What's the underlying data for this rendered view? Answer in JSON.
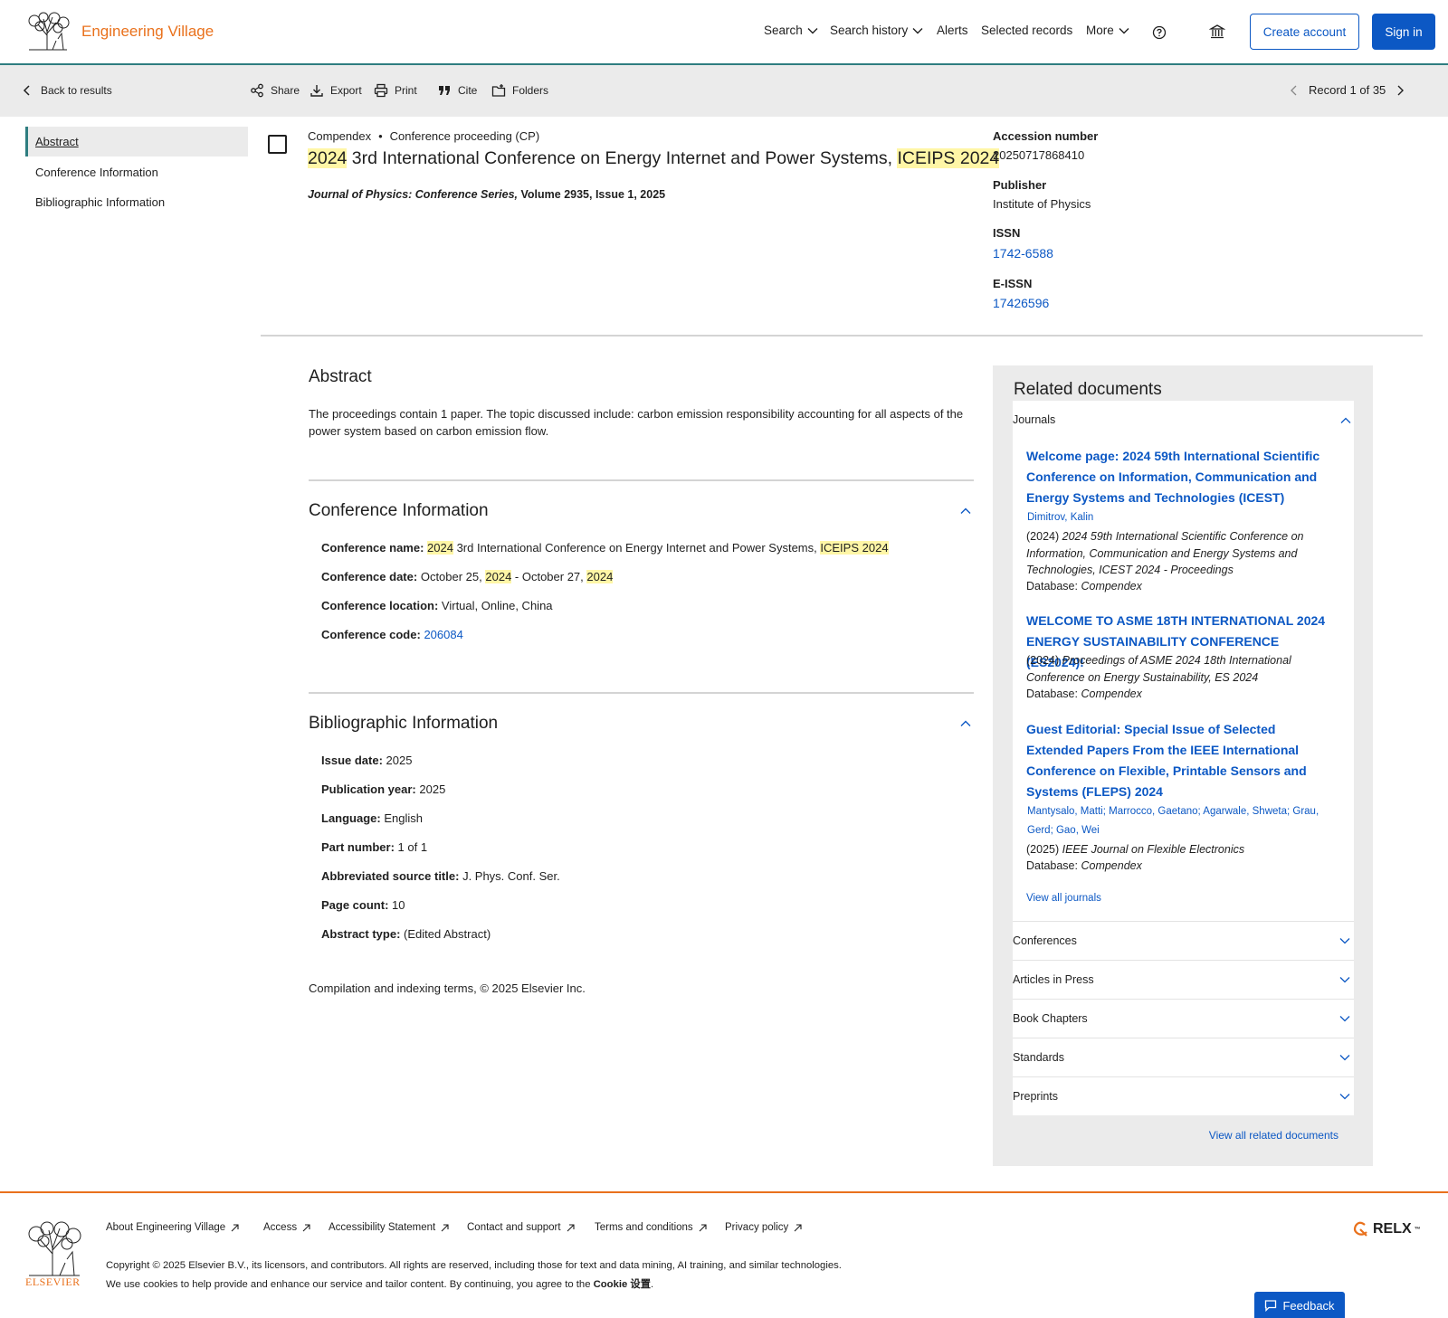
{
  "header": {
    "brand": "Engineering Village",
    "nav": {
      "search": "Search",
      "search_history": "Search history",
      "alerts": "Alerts",
      "selected_records": "Selected records",
      "more": "More"
    },
    "create_account": "Create account",
    "sign_in": "Sign in"
  },
  "toolbar": {
    "back": "Back to results",
    "share": "Share",
    "export": "Export",
    "print": "Print",
    "cite": "Cite",
    "folders": "Folders",
    "record_pager": "Record 1 of 35"
  },
  "left_nav": [
    "Abstract",
    "Conference Information",
    "Bibliographic Information"
  ],
  "record": {
    "database": "Compendex",
    "doc_type": "Conference proceeding (CP)",
    "title_parts": [
      "2024",
      " 3rd International Conference on Energy Internet and Power Systems, ",
      "ICEIPS",
      " ",
      "2024"
    ],
    "journal": "Journal of Physics: Conference Series,",
    "journal_rest": " Volume 2935, Issue 1, 2025"
  },
  "meta": {
    "accession_label": "Accession number",
    "accession": "20250717868410",
    "publisher_label": "Publisher",
    "publisher": "Institute of Physics",
    "issn_label": "ISSN",
    "issn": "1742-6588",
    "eissn_label": "E-ISSN",
    "eissn": "17426596"
  },
  "abstract": {
    "title": "Abstract",
    "text": "The proceedings contain 1 paper. The topic discussed include: carbon emission responsibility accounting for all aspects of the power system based on carbon emission flow."
  },
  "conference": {
    "title": "Conference Information",
    "name_label": "Conference name:",
    "name_parts": [
      "2024",
      " 3rd International Conference on Energy Internet and Power Systems, ",
      "ICEIPS",
      " ",
      "2024"
    ],
    "date_label": "Conference date:",
    "date_parts": [
      "October 25, ",
      "2024",
      " - October 27, ",
      "2024"
    ],
    "location_label": "Conference location:",
    "location": "Virtual, Online, China",
    "code_label": "Conference code:",
    "code": "206084"
  },
  "bibliographic": {
    "title": "Bibliographic Information",
    "fields": [
      {
        "label": "Issue date:",
        "value": "2025"
      },
      {
        "label": "Publication year:",
        "value": "2025"
      },
      {
        "label": "Language:",
        "value": "English"
      },
      {
        "label": "Part number:",
        "value": "1 of 1"
      },
      {
        "label": "Abbreviated source title:",
        "value": "J. Phys. Conf. Ser."
      },
      {
        "label": "Page count:",
        "value": "10"
      },
      {
        "label": "Abstract type:",
        "value": "(Edited Abstract)"
      }
    ]
  },
  "compilation": "Compilation and indexing terms, © 2025 Elsevier Inc.",
  "related": {
    "title": "Related documents",
    "journals_label": "Journals",
    "items": [
      {
        "title": "Welcome page: 2024 59th International Scientific Conference on Information, Communication and Energy Systems and Technologies (ICEST)",
        "authors": "Dimitrov, Kalin",
        "year": "(2024)",
        "source": "2024 59th International Scientific Conference on Information, Communication and Energy Systems and Technologies, ICEST 2024 - Proceedings",
        "db_label": "Database:",
        "db": "Compendex"
      },
      {
        "title": "WELCOME TO ASME 18TH INTERNATIONAL 2024 ENERGY SUSTAINABILITY CONFERENCE (ES2024)!",
        "authors": "",
        "year": "(2024)",
        "source": "Proceedings of ASME 2024 18th International Conference on Energy Sustainability, ES 2024",
        "db_label": "Database:",
        "db": "Compendex"
      },
      {
        "title": "Guest Editorial: Special Issue of Selected Extended Papers From the IEEE International Conference on Flexible, Printable Sensors and Systems (FLEPS) 2024",
        "authors": "Mantysalo, Matti;  Marrocco, Gaetano;  Agarwale, Shweta;  Grau, Gerd;   Gao, Wei",
        "year": "(2025)",
        "source": "IEEE Journal on Flexible Electronics",
        "db_label": "Database:",
        "db": "Compendex"
      }
    ],
    "view_all_journals": "View all journals",
    "sections": [
      "Conferences",
      "Articles in Press",
      "Book Chapters",
      "Standards",
      "Preprints"
    ],
    "view_all": "View all related documents"
  },
  "footer": {
    "elsevier": "ELSEVIER",
    "links": [
      "About Engineering Village",
      "Access",
      "Accessibility Statement",
      "Contact and support",
      "Terms and conditions",
      "Privacy policy"
    ],
    "copyright": "Copyright © 2025 Elsevier B.V., its licensors, and contributors. All rights are reserved, including those for text and data mining, AI training, and similar technologies.",
    "cookie_text": "We use cookies to help provide and enhance our service and tailor content. By continuing, you agree to the ",
    "cookie_link": "Cookie 设置",
    "relx": "RELX",
    "relx_tm": "™",
    "feedback": "Feedback"
  },
  "colors": {
    "accent": "#0c58c4",
    "brand": "#e9711c",
    "teal": "#2e7d80",
    "highlight": "#fff6a6"
  }
}
